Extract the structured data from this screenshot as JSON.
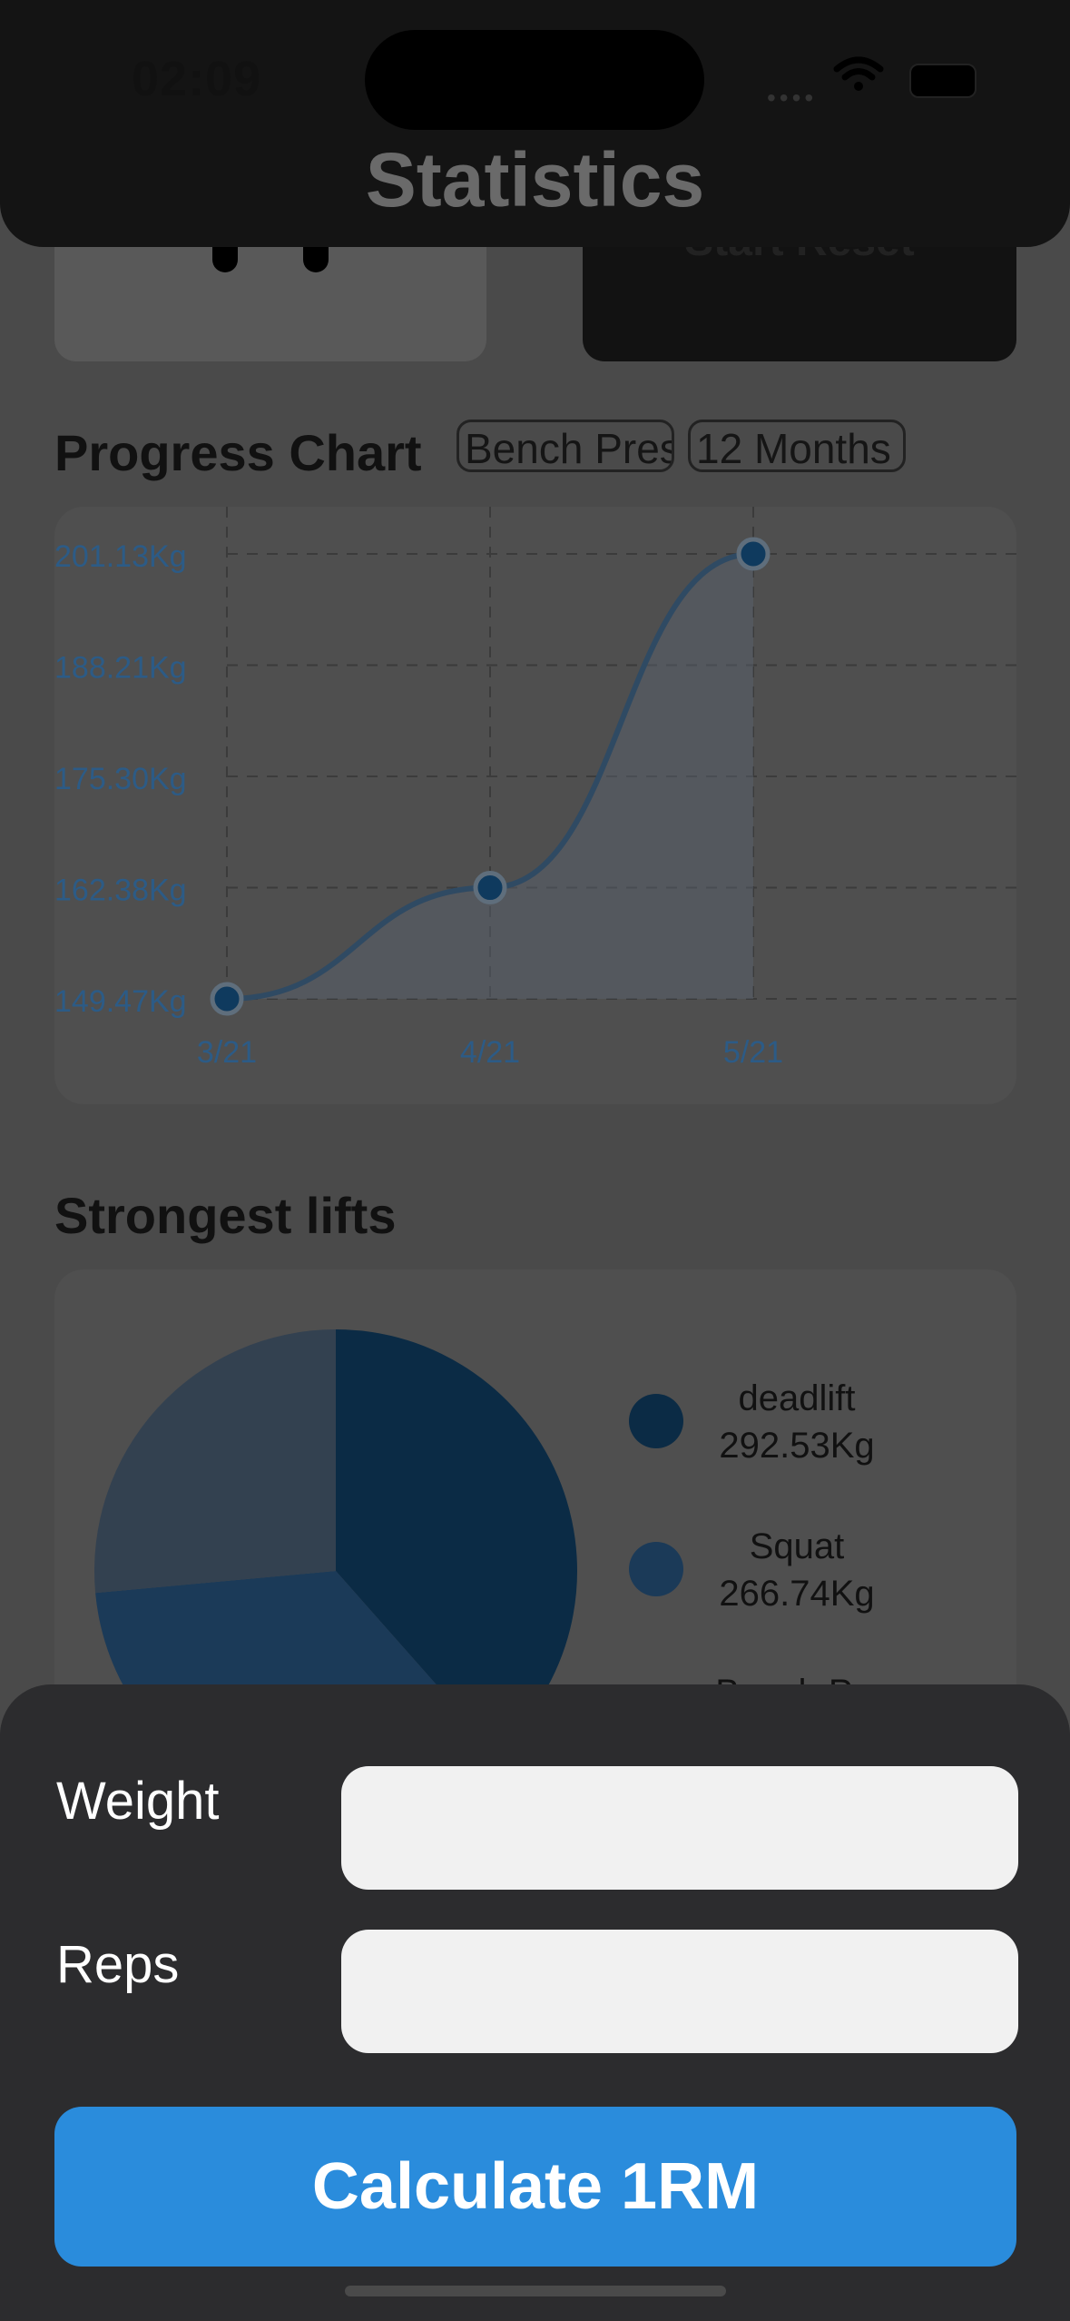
{
  "status_bar": {
    "time": "02:09"
  },
  "header": {
    "title": "Statistics"
  },
  "top_cards": {
    "right_text": "Start Reset"
  },
  "progress": {
    "title": "Progress Chart",
    "exercise_filter": "Bench Press",
    "period_filter": "12 Months"
  },
  "chart_data": {
    "type": "area",
    "x": [
      "3/21",
      "4/21",
      "5/21"
    ],
    "y": [
      149.47,
      162.38,
      201.13
    ],
    "yticks": [
      "201.13Kg",
      "188.21Kg",
      "175.30Kg",
      "162.38Kg",
      "149.47Kg"
    ],
    "ylim": [
      149.47,
      201.13
    ],
    "grid": true,
    "colors": {
      "line": "#2f4a63",
      "point": "#0f3a5e",
      "fill": "#5a6470"
    }
  },
  "strongest": {
    "title": "Strongest lifts",
    "chart": {
      "type": "pie",
      "slices": [
        {
          "name": "deadlift",
          "value": 292.53,
          "color": "#0b2b45"
        },
        {
          "name": "Squat",
          "value": 266.74,
          "color": "#1b3a58"
        },
        {
          "name": "Bench Press",
          "value": 201.13,
          "color": "#334150"
        }
      ]
    },
    "legend": [
      {
        "name": "deadlift",
        "value": "292.53Kg",
        "color": "#0b2b45"
      },
      {
        "name": "Squat",
        "value": "266.74Kg",
        "color": "#1b3a58"
      },
      {
        "name": "Bench P...",
        "value": "",
        "color": "#334150"
      }
    ]
  },
  "calculator": {
    "weight_label": "Weight",
    "reps_label": "Reps",
    "weight_value": "",
    "reps_value": "",
    "button": "Calculate 1RM"
  }
}
